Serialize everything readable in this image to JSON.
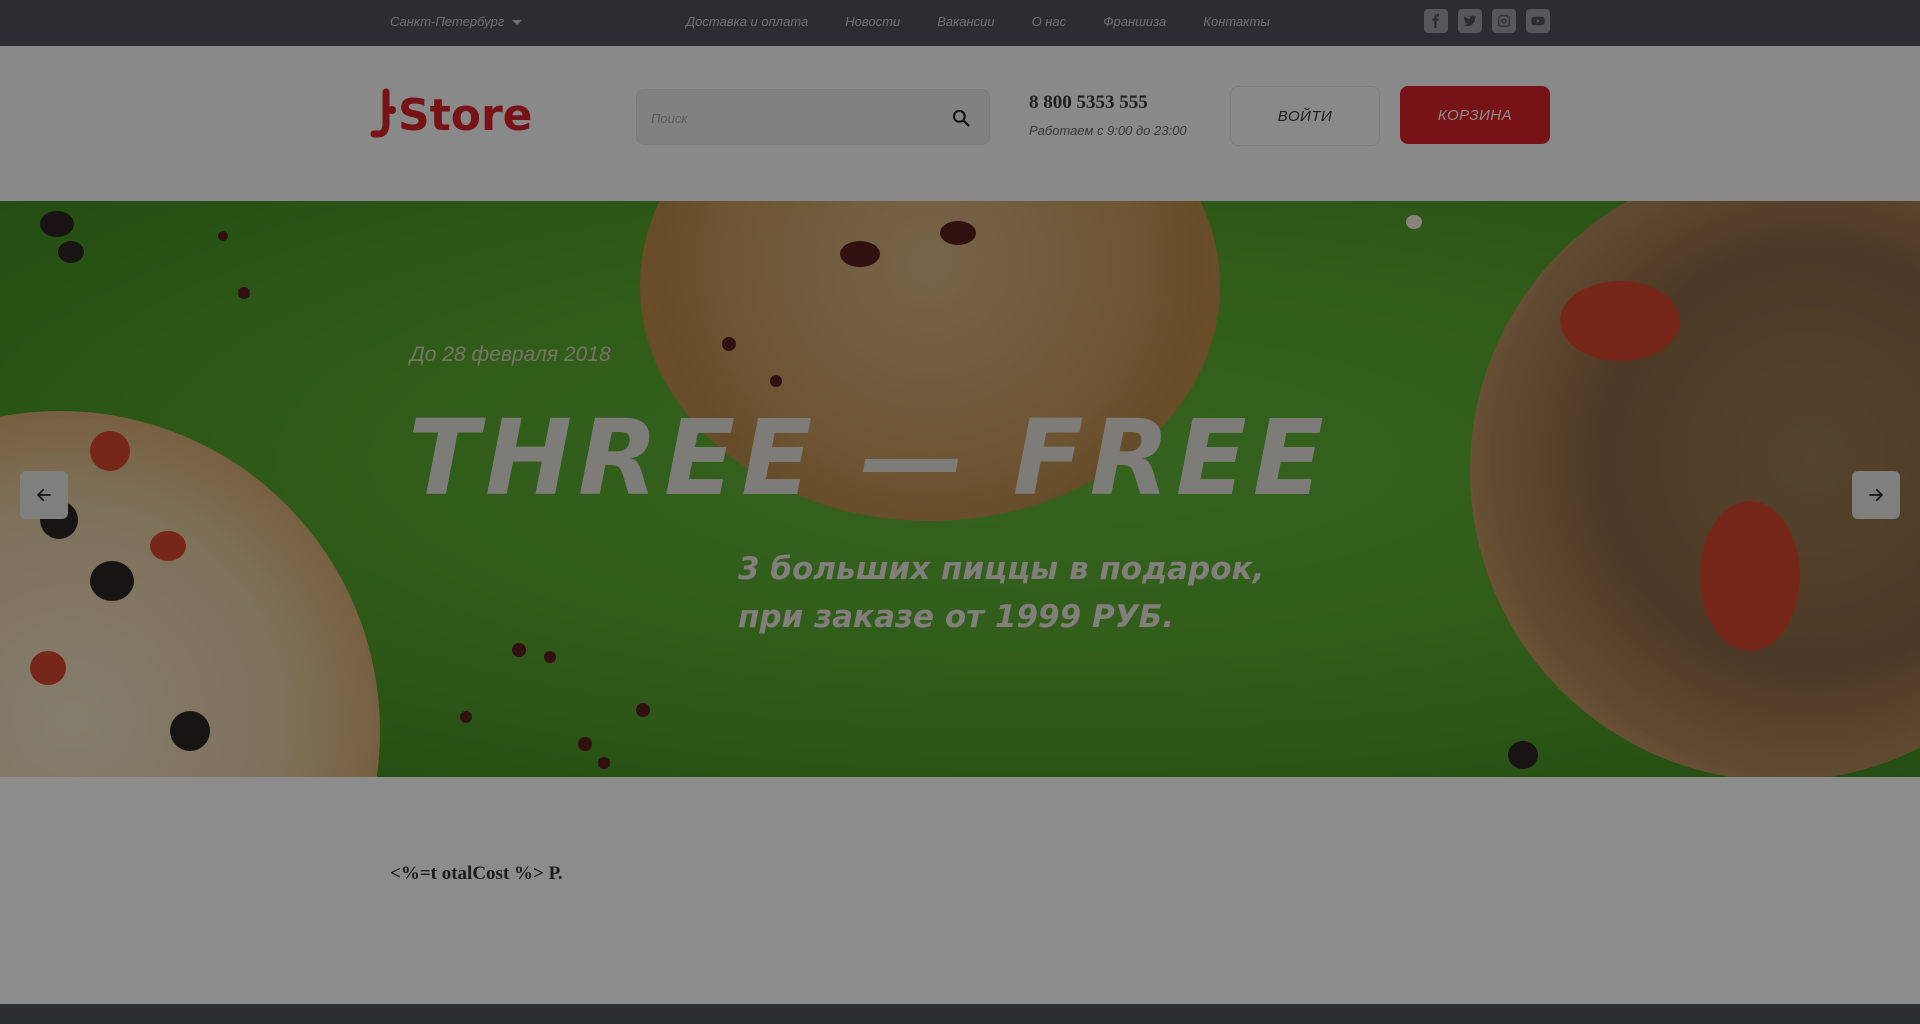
{
  "topbar": {
    "city": "Санкт-Петербург",
    "nav": [
      "Доставка и оплата",
      "Новости",
      "Вакансии",
      "О нас",
      "Франшиза",
      "Контакты"
    ],
    "socials": [
      "facebook-icon",
      "twitter-icon",
      "instagram-icon",
      "youtube-icon"
    ]
  },
  "header": {
    "logo_text": "JStore",
    "search_placeholder": "Поиск",
    "phone": "8 800 5353 555",
    "hours": "Работаем с 9:00 до 23:00",
    "login_label": "ВОЙТИ",
    "cart_label": "КОРЗИНА"
  },
  "banner": {
    "date": "До 28 февраля 2018",
    "title": "THREE — FREE",
    "subtitle_line1": "3 больших пиццы в подарок,",
    "subtitle_line2": "при заказе от 1999 РУБ."
  },
  "content": {
    "total": "<%=t otalCost %> Р."
  },
  "colors": {
    "topbar": "#4f535c",
    "brand_red": "#d9232a",
    "banner_green": "#5aab32"
  }
}
